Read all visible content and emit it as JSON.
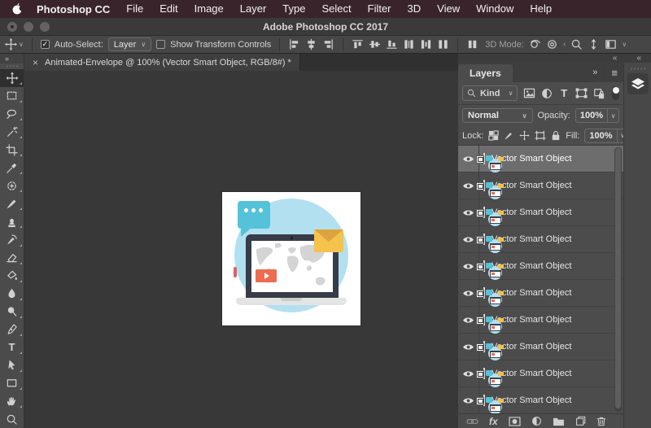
{
  "menu_bar": {
    "app_name": "Photoshop CC",
    "items": [
      "File",
      "Edit",
      "Image",
      "Layer",
      "Type",
      "Select",
      "Filter",
      "3D",
      "View",
      "Window",
      "Help"
    ]
  },
  "title_bar": {
    "title": "Adobe Photoshop CC 2017"
  },
  "options_bar": {
    "auto_select_label": "Auto-Select:",
    "auto_select_value": "Layer",
    "show_transform_label": "Show Transform Controls",
    "threed_mode_label": "3D Mode:"
  },
  "document_tab": {
    "title": "Animated-Envelope @ 100% (Vector Smart Object, RGB/8#) *"
  },
  "tools": [
    "move",
    "rectangular-marquee",
    "lasso",
    "magic-wand",
    "crop",
    "eyedropper",
    "healing-brush",
    "brush",
    "clone-stamp",
    "history-brush",
    "eraser",
    "paint-bucket",
    "blur",
    "dodge",
    "pen",
    "type",
    "path-selection",
    "rectangle",
    "hand",
    "zoom"
  ],
  "layers_panel": {
    "tab_label": "Layers",
    "filter_kind_label": "Kind",
    "filter_icons": [
      "pixel-layer-filter-icon",
      "adjustment-layer-filter-icon",
      "type-layer-filter-icon",
      "shape-layer-filter-icon",
      "smart-object-filter-icon",
      "filtering-toggle"
    ],
    "blend_mode_value": "Normal",
    "opacity_label": "Opacity:",
    "opacity_value": "100%",
    "lock_label": "Lock:",
    "lock_icons": [
      "lock-transparent-pixels-icon",
      "lock-image-pixels-icon",
      "lock-position-icon",
      "lock-artboard-icon",
      "lock-all-icon"
    ],
    "fill_label": "Fill:",
    "fill_value": "100%",
    "footer_fx_label": "fx",
    "footer_icons": [
      "link-layers-icon",
      "layer-style-icon",
      "layer-mask-icon",
      "adjustment-layer-icon",
      "group-icon",
      "new-layer-icon",
      "delete-layer-icon"
    ],
    "layers": [
      {
        "name": "Vector Smart Object",
        "visible": true,
        "selected": true
      },
      {
        "name": "Vector Smart Object",
        "visible": true
      },
      {
        "name": "Vector Smart Object",
        "visible": true
      },
      {
        "name": "Vector Smart Object",
        "visible": true
      },
      {
        "name": "Vector Smart Object",
        "visible": true
      },
      {
        "name": "Vector Smart Object",
        "visible": true
      },
      {
        "name": "Vector Smart Object",
        "visible": true
      },
      {
        "name": "Vector Smart Object",
        "visible": true
      },
      {
        "name": "Vector Smart Object",
        "visible": true
      },
      {
        "name": "Vector Smart Object",
        "visible": true
      }
    ]
  },
  "glyphs": {
    "close": "×",
    "chevron": "∨",
    "collapse": "«",
    "expand": "»",
    "check": "✓",
    "panel_menu": "≡",
    "type_tool": "T"
  },
  "colors": {
    "menubar_bg": "#3a242b",
    "panel_bg": "#4c4c4c",
    "canvas_bg": "#383838",
    "selection_row": "#6d6d6d",
    "circle_blue": "#b3e0f0",
    "bubble_teal": "#54c3d9",
    "envelope_yellow": "#f5c24b",
    "envelope_flap": "#dca33f",
    "play_orange": "#ee6b4e",
    "laptop_dark": "#373c48",
    "map_gray": "#d4d4d4"
  }
}
